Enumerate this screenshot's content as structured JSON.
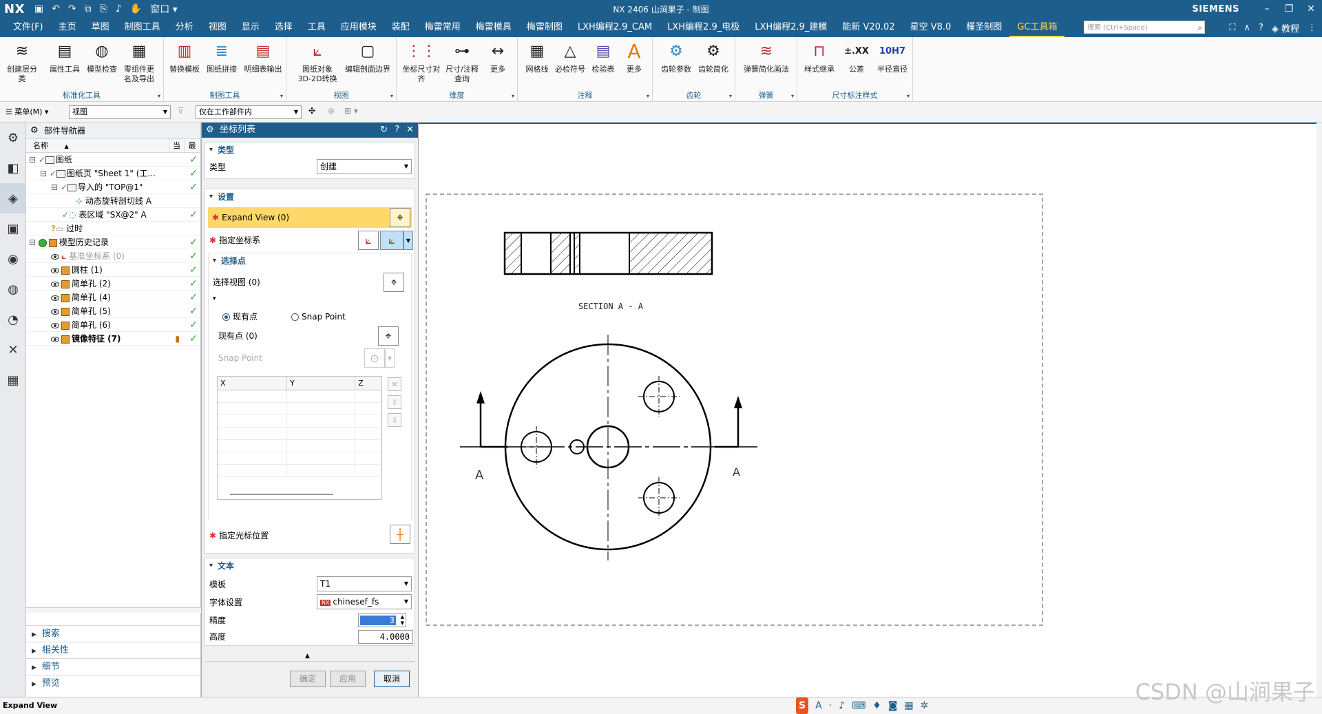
{
  "titlebar": {
    "logo": "NX",
    "title": "NX 2406 山涧果子 - 制图",
    "window_menu": "窗口",
    "brand": "SIEMENS"
  },
  "menubar": {
    "file": "文件(F)",
    "items": [
      "主页",
      "草图",
      "制图工具",
      "分析",
      "视图",
      "显示",
      "选择",
      "工具",
      "应用模块",
      "装配",
      "梅雷常用",
      "梅雷模具",
      "梅雷制图",
      "LXH编程2.9_CAM",
      "LXH编程2.9_电极",
      "LXH编程2.9_建模",
      "能新 V20.02",
      "星空 V8.0",
      "槿圣制图",
      "GC工具箱"
    ],
    "active": "GC工具箱",
    "search_placeholder": "搜索 (Ctrl+Space)",
    "tutorial": "教程"
  },
  "ribbon": {
    "groups": [
      {
        "label": "标准化工具",
        "buttons": [
          "创建层分类",
          "属性工具",
          "模型检查",
          "零组件更名及导出"
        ]
      },
      {
        "label": "制图工具",
        "buttons": [
          "替换模板",
          "图纸拼接",
          "明细表输出"
        ]
      },
      {
        "label": "视图",
        "buttons": [
          "图纸对象3D-2D转换",
          "编辑剖面边界"
        ]
      },
      {
        "label": "维度",
        "buttons": [
          "坐标尺寸对齐",
          "尺寸/注释查询",
          "更多"
        ]
      },
      {
        "label": "注释",
        "buttons": [
          "网格线",
          "必检符号",
          "检验表",
          "更多"
        ]
      },
      {
        "label": "齿轮",
        "buttons": [
          "齿轮参数",
          "齿轮简化"
        ]
      },
      {
        "label": "弹簧",
        "buttons": [
          "弹簧简化画法"
        ]
      },
      {
        "label": "尺寸标注样式",
        "buttons": [
          "样式继承",
          "公差",
          "半径直径"
        ]
      }
    ],
    "icon_text": {
      "tolerance": "±.XX",
      "fit": "10H7"
    }
  },
  "toolrow": {
    "menu": "菜单(M)",
    "view_combo": "视图",
    "scope_combo": "仅在工作部件内"
  },
  "navigator": {
    "title": "部件导航器",
    "col_name": "名称",
    "col_current": "当",
    "col_latest": "最",
    "rows": [
      {
        "text": "图纸",
        "indent": 0
      },
      {
        "text": "图纸页 \"Sheet 1\" (工...",
        "indent": 1
      },
      {
        "text": "导入的 \"TOP@1\"",
        "indent": 2
      },
      {
        "text": "动态旋转剖切线 A",
        "indent": 3
      },
      {
        "text": "表区域 \"SX@2\" A",
        "indent": 2
      },
      {
        "text": "过时",
        "indent": 1
      },
      {
        "text": "模型历史记录",
        "indent": 0
      },
      {
        "text": "基准坐标系 (0)",
        "indent": 1
      },
      {
        "text": "圆柱 (1)",
        "indent": 1
      },
      {
        "text": "简单孔 (2)",
        "indent": 1
      },
      {
        "text": "简单孔 (4)",
        "indent": 1
      },
      {
        "text": "简单孔 (5)",
        "indent": 1
      },
      {
        "text": "简单孔 (6)",
        "indent": 1
      },
      {
        "text": "镜像特征 (7)",
        "indent": 1
      }
    ],
    "bottom": [
      "搜索",
      "相关性",
      "细节",
      "预览"
    ]
  },
  "dialog": {
    "title": "坐标列表",
    "sec_type": "类型",
    "type_label": "类型",
    "type_value": "创建",
    "sec_settings": "设置",
    "expand_view": "Expand View (0)",
    "specify_csys": "指定坐标系",
    "sec_select_points": "选择点",
    "select_view": "选择视图 (0)",
    "radio_existing": "现有点",
    "radio_snap": "Snap Point",
    "existing_count": "现有点 (0)",
    "snap_point": "Snap Point",
    "table_cols": [
      "X",
      "Y",
      "Z"
    ],
    "specify_cursor": "指定光标位置",
    "sec_text": "文本",
    "template_label": "模板",
    "template_value": "T1",
    "font_label": "字体设置",
    "font_value": "chinesef_fs",
    "precision_label": "精度",
    "precision_value": "3",
    "height_label": "高度",
    "height_value": "4.0000",
    "ok": "确定",
    "apply": "应用",
    "cancel": "取消"
  },
  "drawing": {
    "section_label": "SECTION A - A",
    "arrow_left": "A",
    "arrow_right": "A"
  },
  "statusbar": {
    "text": "Expand View"
  },
  "watermark": "CSDN @山涧果子"
}
